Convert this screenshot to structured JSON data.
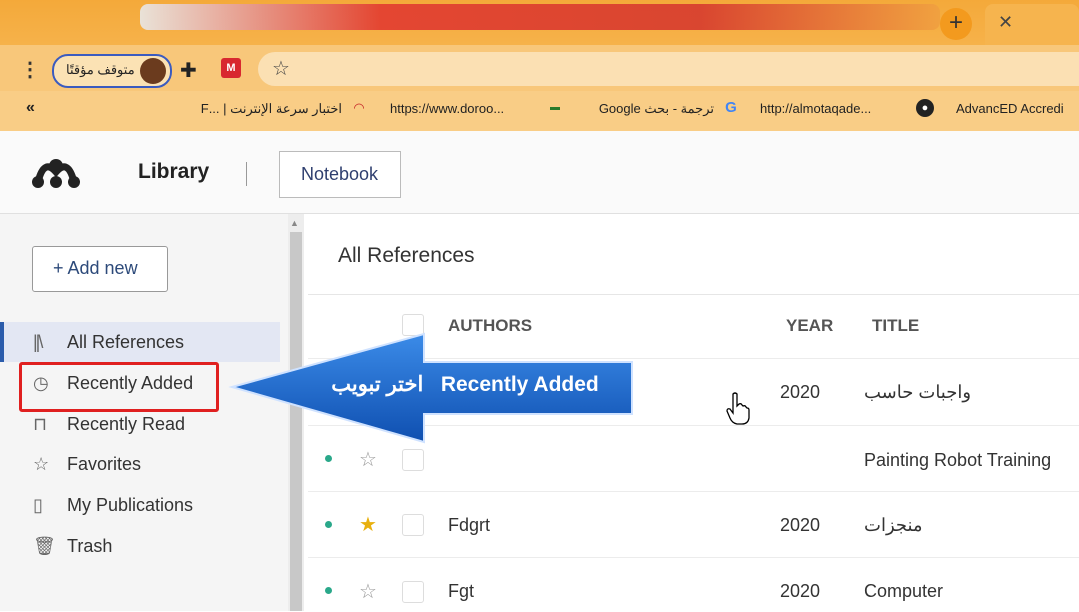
{
  "browser": {
    "paused_label": "متوقف مؤقتًا",
    "bookmarks": [
      {
        "icon": "globe-icon",
        "text": "AdvancED Accredi"
      },
      {
        "icon": "globe-icon",
        "text": "http://almotaqade..."
      },
      {
        "icon": "google-icon",
        "text": "ترجمة - بحث Google"
      },
      {
        "icon": "site-icon",
        "text": "https://www.doroo..."
      },
      {
        "icon": "speed-icon",
        "text": "اختبار سرعة الإنترنت | ...F"
      }
    ],
    "more_bookmarks": "«"
  },
  "app": {
    "library_label": "Library",
    "notebook_label": "Notebook",
    "add_new_label": "+ Add new",
    "nav": [
      {
        "icon": "library-icon",
        "label": "All References",
        "selected": true
      },
      {
        "icon": "clock-icon",
        "label": "Recently Added"
      },
      {
        "icon": "bookmark-icon",
        "label": "Recently Read"
      },
      {
        "icon": "star-icon",
        "label": "Favorites"
      },
      {
        "icon": "publications-icon",
        "label": "My Publications"
      },
      {
        "icon": "trash-icon",
        "label": "Trash"
      }
    ],
    "main_title": "All References",
    "columns": {
      "authors": "AUTHORS",
      "year": "YEAR",
      "title": "TITLE"
    },
    "rows": [
      {
        "starred": false,
        "authors": "",
        "year": "2020",
        "title": "واجبات حاسب"
      },
      {
        "starred": false,
        "authors": "",
        "year": "",
        "title": "Painting Robot Training"
      },
      {
        "starred": true,
        "authors": "Fdgrt",
        "year": "2020",
        "title": "منجزات"
      },
      {
        "starred": false,
        "authors": "Fgt",
        "year": "2020",
        "title": "Computer"
      }
    ]
  },
  "annotation": {
    "arrow_text": "اختر تبويب   Recently Added",
    "arrow_color": "#1f63c9",
    "highlight_color": "#e02020"
  }
}
